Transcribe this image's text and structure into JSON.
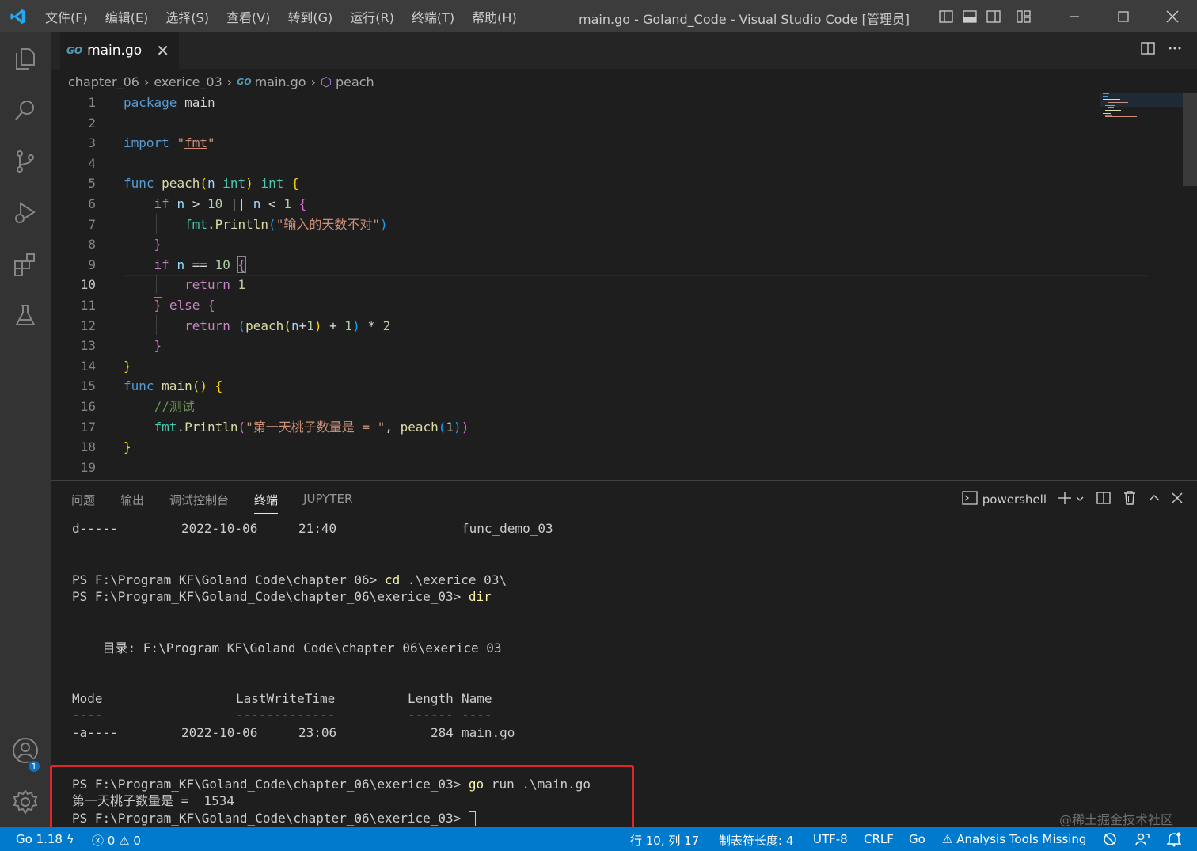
{
  "titlebar": {
    "menu": [
      "文件(F)",
      "编辑(E)",
      "选择(S)",
      "查看(V)",
      "转到(G)",
      "运行(R)",
      "终端(T)",
      "帮助(H)"
    ],
    "title": "main.go - Goland_Code - Visual Studio Code [管理员]"
  },
  "tab": {
    "icon_text": "GO",
    "filename": "main.go",
    "close": "✕"
  },
  "breadcrumb": [
    "chapter_06",
    "exerice_03",
    "main.go",
    "peach"
  ],
  "code": {
    "current_line": 10,
    "line_numbers": [
      "1",
      "2",
      "3",
      "4",
      "5",
      "6",
      "7",
      "8",
      "9",
      "10",
      "11",
      "12",
      "13",
      "14",
      "15",
      "16",
      "17",
      "18",
      "19"
    ]
  },
  "panel": {
    "tabs": [
      "问题",
      "输出",
      "调试控制台",
      "终端",
      "JUPYTER"
    ],
    "active_tab": "终端",
    "shell": "powershell"
  },
  "terminal": {
    "l1_mode": "d-----",
    "l1_date": "2022-10-06",
    "l1_time": "21:40",
    "l1_name": "func_demo_03",
    "l2_prompt": "PS F:\\Program_KF\\Goland_Code\\chapter_06> ",
    "l2_cmd": "cd",
    "l2_arg": " .\\exerice_03\\",
    "l3_prompt": "PS F:\\Program_KF\\Goland_Code\\chapter_06\\exerice_03> ",
    "l3_cmd": "dir",
    "dir_label": "    目录: F:\\Program_KF\\Goland_Code\\chapter_06\\exerice_03",
    "hdr_mode": "Mode",
    "hdr_lwt": "LastWriteTime",
    "hdr_len": "Length",
    "hdr_name": "Name",
    "dash_mode": "----",
    "dash_lwt": "-------------",
    "dash_len": "------",
    "dash_name": "----",
    "f_mode": "-a----",
    "f_date": "2022-10-06",
    "f_time": "23:06",
    "f_len": "284",
    "f_name": "main.go",
    "l4_prompt": "PS F:\\Program_KF\\Goland_Code\\chapter_06\\exerice_03> ",
    "l4_cmd": "go",
    "l4_arg": " run .\\main.go",
    "output": "第一天桃子数量是 =  1534",
    "l5_prompt": "PS F:\\Program_KF\\Goland_Code\\chapter_06\\exerice_03> "
  },
  "watermark": "@稀土掘金技术社区",
  "status": {
    "go_version": "Go 1.18",
    "errors": "0",
    "warnings": "0",
    "position": "行 10, 列 17",
    "tab_size": "制表符长度: 4",
    "encoding": "UTF-8",
    "eol": "CRLF",
    "language": "Go",
    "analysis": "Analysis Tools Missing"
  },
  "account_badge": "1",
  "colors": {
    "accent": "#007acc",
    "highlight_box": "#e0262a"
  }
}
